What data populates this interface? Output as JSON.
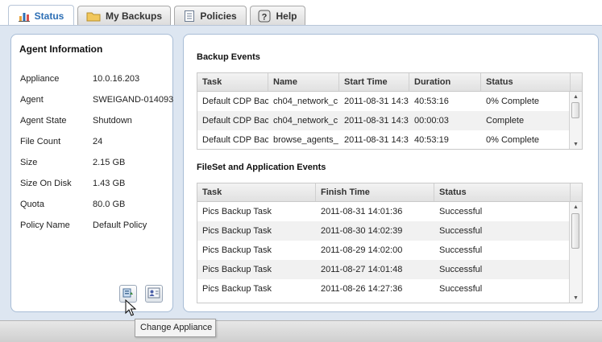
{
  "tabs": [
    {
      "label": "Status",
      "icon": "bar-chart-icon",
      "active": true
    },
    {
      "label": "My Backups",
      "icon": "folder-icon",
      "active": false
    },
    {
      "label": "Policies",
      "icon": "document-icon",
      "active": false
    },
    {
      "label": "Help",
      "icon": "help-icon",
      "active": false
    }
  ],
  "agent_info": {
    "title": "Agent Information",
    "rows": [
      {
        "label": "Appliance",
        "value": "10.0.16.203"
      },
      {
        "label": "Agent",
        "value": "SWEIGAND-014093"
      },
      {
        "label": "Agent State",
        "value": "Shutdown"
      },
      {
        "label": "File Count",
        "value": "24"
      },
      {
        "label": "Size",
        "value": "2.15 GB"
      },
      {
        "label": "Size On Disk",
        "value": "1.43 GB"
      },
      {
        "label": "Quota",
        "value": "80.0 GB"
      },
      {
        "label": "Policy Name",
        "value": "Default Policy"
      }
    ]
  },
  "backup_events": {
    "title": "Backup Events",
    "columns": [
      "Task",
      "Name",
      "Start Time",
      "Duration",
      "Status"
    ],
    "rows": [
      [
        "Default CDP Bac",
        "ch04_network_c",
        "2011-08-31 14:3",
        "40:53:16",
        "0% Complete"
      ],
      [
        "Default CDP Bac",
        "ch04_network_c",
        "2011-08-31 14:3",
        "00:00:03",
        "Complete"
      ],
      [
        "Default CDP Bac",
        "browse_agents_",
        "2011-08-31 14:3",
        "40:53:19",
        "0% Complete"
      ]
    ]
  },
  "fileset_events": {
    "title": "FileSet and Application Events",
    "columns": [
      "Task",
      "Finish Time",
      "Status"
    ],
    "rows": [
      [
        "Pics Backup Task",
        "2011-08-31 14:01:36",
        "Successful"
      ],
      [
        "Pics Backup Task",
        "2011-08-30 14:02:39",
        "Successful"
      ],
      [
        "Pics Backup Task",
        "2011-08-29 14:02:00",
        "Successful"
      ],
      [
        "Pics Backup Task",
        "2011-08-27 14:01:48",
        "Successful"
      ],
      [
        "Pics Backup Task",
        "2011-08-26 14:27:36",
        "Successful"
      ]
    ]
  },
  "tooltip": {
    "text": "Change Appliance"
  },
  "colors": {
    "accent": "#2d6fb5",
    "panel_border": "#a8bdd6",
    "background": "#dde6f1"
  }
}
